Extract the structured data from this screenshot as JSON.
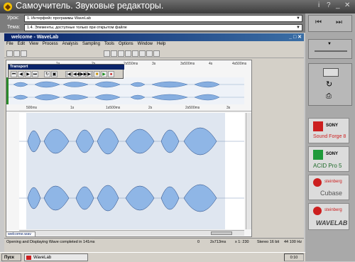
{
  "window": {
    "title": "Самоучитель. Звуковые редакторы."
  },
  "lesson": {
    "lesson_label": "Урок:",
    "lesson_value": "1. Интерфейс программы WaveLab",
    "topic_label": "Тема:",
    "topic_value": "1.4. Элементы, доступные только при открытом файле"
  },
  "wavelab": {
    "title": "welcome - WaveLab",
    "menu": [
      "File",
      "Edit",
      "View",
      "Process",
      "Analysis",
      "Sampling",
      "Tools",
      "Options",
      "Window",
      "Help"
    ],
    "transport_title": "Transport",
    "ruler_top": [
      "1s",
      "2s",
      "2s550ms",
      "3s",
      "3s500ms",
      "4s",
      "4s500ms"
    ],
    "ruler_main": [
      "500ms",
      "1s",
      "1s500ms",
      "2s",
      "2s500ms",
      "3s"
    ],
    "doc_tab": "welcome.wav",
    "status": {
      "message": "Opening and Displaying Wave completed in 141ms",
      "pos": "0",
      "length": "2s713ms",
      "zoom": "x 1: 230",
      "format": "Stereo 16 bit",
      "rate": "44 100 Hz"
    }
  },
  "products": [
    {
      "brand": "SONY",
      "name": "Sound Forge 8",
      "color": "#cc1f1f"
    },
    {
      "brand": "SONY",
      "name": "ACID Pro 5",
      "color": "#1f9a3a"
    },
    {
      "brand": "steinberg",
      "name": "Cubase",
      "color": "#cc1f1f"
    },
    {
      "brand": "steinberg",
      "name": "WAVELAB",
      "color": "#cc1f1f"
    }
  ],
  "taskbar": {
    "start": "Пуск",
    "task": "WaveLab",
    "clock": "0:10"
  }
}
